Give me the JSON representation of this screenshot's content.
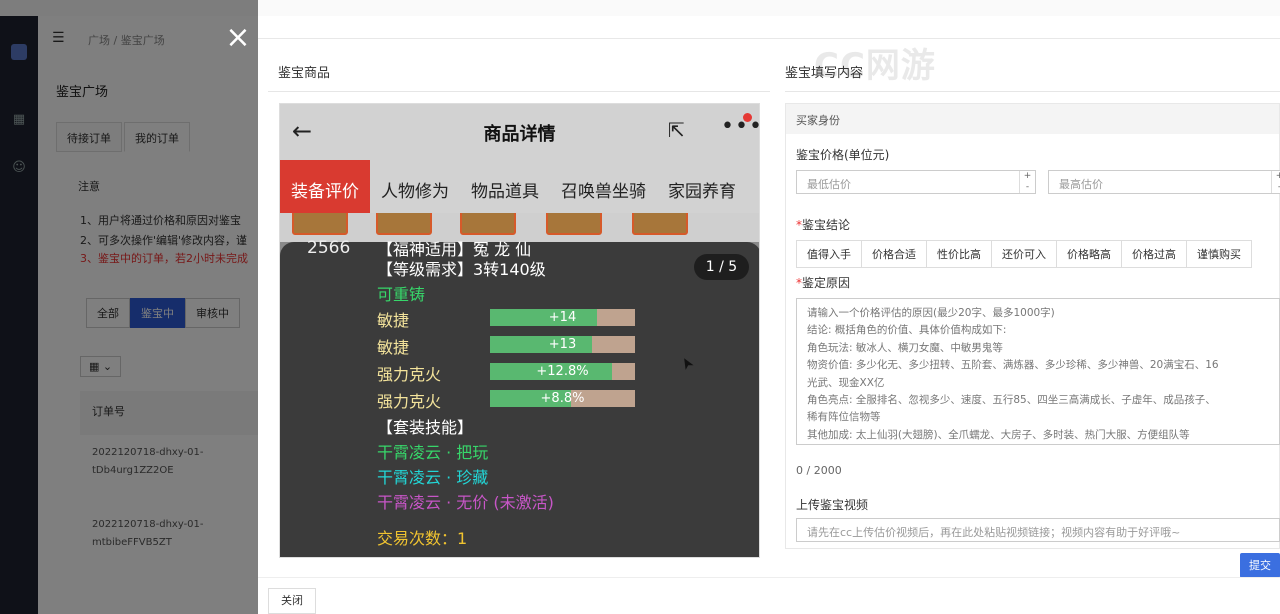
{
  "background": {
    "breadcrumb": "广场 / 鉴宝广场",
    "page_title": "鉴宝广场",
    "tabs": [
      "待接订单",
      "我的订单"
    ],
    "notice_title": "注意",
    "notice_lines": [
      "1、用户将通过价格和原因对鉴宝",
      "2、可多次操作'编辑'修改内容，谨",
      "3、鉴宝中的订单，若2小时未完成"
    ],
    "filters": [
      "全部",
      "鉴宝中",
      "审核中"
    ],
    "grid_button": "▦ ⌄",
    "table_header": "订单号",
    "orders": [
      "2022120718-dhxy-01-",
      "tDb4urg1ZZ2OE",
      "2022120718-dhxy-01-",
      "mtbibeFFVB5ZT"
    ]
  },
  "drawer": {
    "close_icon": "×",
    "left_section_title": "鉴宝商品",
    "right_section_title": "鉴宝填写内容",
    "watermark": "CC网游",
    "close_button": "关闭",
    "submit_button": "提交"
  },
  "phone": {
    "back_icon": "←",
    "title": "商品详情",
    "share_icon": "⇱",
    "more_icon": "•••",
    "tabs": [
      "装备评价",
      "人物修为",
      "物品道具",
      "召唤兽坐骑",
      "家园养育"
    ],
    "count": "2566",
    "pager": "1 / 5",
    "lines": [
      {
        "text": "【等级需求】3转140级",
        "color": "#ffffff"
      },
      {
        "text": "可重铸",
        "color": "#37d66a"
      },
      {
        "text": "【套装技能】",
        "color": "#ffffff"
      },
      {
        "text": "干霄凌云 · 把玩",
        "color": "#37d66a"
      },
      {
        "text": "干霄凌云 · 珍藏",
        "color": "#22d6d6"
      },
      {
        "text": "干霄凌云 · 无价 (未激活)",
        "color": "#c756c7"
      },
      {
        "text": "交易次数：1",
        "color": "#f0c330"
      }
    ],
    "top_cut_line": "【福神适用】冤  龙  仙",
    "attrs": [
      {
        "name": "敏捷",
        "value": "+14",
        "fill": 0.74
      },
      {
        "name": "敏捷",
        "value": "+13",
        "fill": 0.7
      },
      {
        "name": "强力克火",
        "value": "+12.8%",
        "fill": 0.84
      },
      {
        "name": "强力克火",
        "value": "+8.8%",
        "fill": 0.56
      }
    ]
  },
  "form": {
    "buyer_band": "买家身份",
    "price_label": "鉴宝价格(单位元)",
    "min_placeholder": "最低估价",
    "max_placeholder": "最高估价",
    "conclusion_label": "鉴宝结论",
    "conclusions": [
      "值得入手",
      "价格合适",
      "性价比高",
      "还价可入",
      "价格略高",
      "价格过高",
      "谨慎购买"
    ],
    "reason_label": "鉴定原因",
    "reason_placeholder_lines": [
      "请输入一个价格评估的原因(最少20字、最多1000字)",
      "  结论: 概括角色的价值、具体价值构成如下:",
      "  角色玩法: 敏冰人、横刀女魔、中敏男鬼等",
      "  物资价值: 多少化无、多少扭转、五阶套、满炼器、多少珍稀、多少神兽、20满宝石、16",
      "光武、现金XX亿",
      "  角色亮点: 全服排名、忽视多少、速度、五行85、四坐三高满成长、子虚年、成品孩子、",
      "稀有阵位信物等",
      "  其他加成: 太上仙羽(大翅膀)、全爪蠕龙、大房子、多时装、热门大服、方便组队等"
    ],
    "counter": "0 / 2000",
    "video_label": "上传鉴宝视频",
    "video_placeholder": "请先在cc上传估价视频后，再在此处粘贴视频链接；视频内容有助于好评哦~"
  }
}
